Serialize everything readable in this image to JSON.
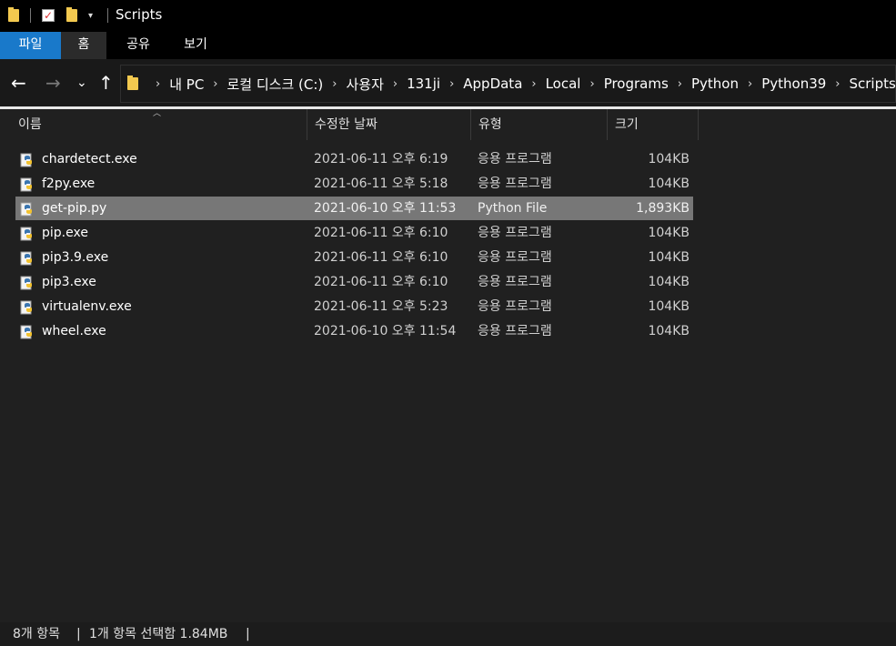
{
  "window": {
    "title": "Scripts"
  },
  "ribbon": {
    "tabs": [
      "파일",
      "홈",
      "공유",
      "보기"
    ]
  },
  "address": {
    "crumbs": [
      "내 PC",
      "로컬 디스크 (C:)",
      "사용자",
      "131ji",
      "AppData",
      "Local",
      "Programs",
      "Python",
      "Python39",
      "Scripts"
    ]
  },
  "columns": {
    "name": "이름",
    "date": "수정한 날짜",
    "type": "유형",
    "size": "크기"
  },
  "files": [
    {
      "name": "chardetect.exe",
      "date": "2021-06-11 오후 6:19",
      "type": "응용 프로그램",
      "size": "104KB",
      "selected": false
    },
    {
      "name": "f2py.exe",
      "date": "2021-06-11 오후 5:18",
      "type": "응용 프로그램",
      "size": "104KB",
      "selected": false
    },
    {
      "name": "get-pip.py",
      "date": "2021-06-10 오후 11:53",
      "type": "Python File",
      "size": "1,893KB",
      "selected": true
    },
    {
      "name": "pip.exe",
      "date": "2021-06-11 오후 6:10",
      "type": "응용 프로그램",
      "size": "104KB",
      "selected": false
    },
    {
      "name": "pip3.9.exe",
      "date": "2021-06-11 오후 6:10",
      "type": "응용 프로그램",
      "size": "104KB",
      "selected": false
    },
    {
      "name": "pip3.exe",
      "date": "2021-06-11 오후 6:10",
      "type": "응용 프로그램",
      "size": "104KB",
      "selected": false
    },
    {
      "name": "virtualenv.exe",
      "date": "2021-06-11 오후 5:23",
      "type": "응용 프로그램",
      "size": "104KB",
      "selected": false
    },
    {
      "name": "wheel.exe",
      "date": "2021-06-10 오후 11:54",
      "type": "응용 프로그램",
      "size": "104KB",
      "selected": false
    }
  ],
  "status": {
    "count": "8개 항목",
    "selection": "1개 항목 선택함 1.84MB"
  },
  "colors": {
    "accent": "#1979ca",
    "selected_row": "#777777",
    "background": "#202020"
  }
}
